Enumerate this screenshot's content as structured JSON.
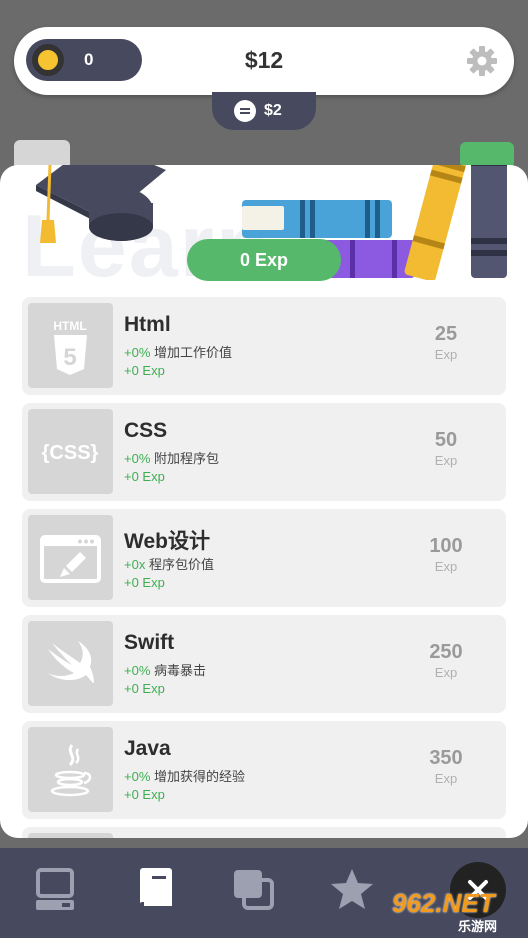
{
  "topbar": {
    "coins": "0",
    "money": "$12"
  },
  "subbar": {
    "value": "$2"
  },
  "panel": {
    "bg_word": "Learn",
    "exp": "0 Exp"
  },
  "courses": [
    {
      "name": "Html",
      "pct": "+0%",
      "effect": "增加工作价值",
      "exp": "+0 Exp",
      "cost": "25",
      "cost_unit": "Exp"
    },
    {
      "name": "CSS",
      "pct": "+0%",
      "effect": "附加程序包",
      "exp": "+0 Exp",
      "cost": "50",
      "cost_unit": "Exp"
    },
    {
      "name": "Web设计",
      "pct": "+0x",
      "effect": "程序包价值",
      "exp": "+0 Exp",
      "cost": "100",
      "cost_unit": "Exp"
    },
    {
      "name": "Swift",
      "pct": "+0%",
      "effect": "病毒暴击",
      "exp": "+0 Exp",
      "cost": "250",
      "cost_unit": "Exp"
    },
    {
      "name": "Java",
      "pct": "+0%",
      "effect": "增加获得的经验",
      "exp": "+0 Exp",
      "cost": "350",
      "cost_unit": "Exp"
    }
  ],
  "thumbs": {
    "html_label": "HTML",
    "html_digit": "5",
    "css_label": "{CSS}"
  },
  "colors": {
    "accent_green": "#55b86a",
    "nav_bg": "#474a5e",
    "coin": "#f7c431"
  },
  "icons": [
    "coin-icon",
    "gear-icon",
    "note-icon",
    "graduation-cap-icon",
    "books-icon",
    "computer-icon",
    "book-icon",
    "layers-icon",
    "star-icon",
    "close-icon"
  ],
  "watermark": {
    "brand": "962.NET",
    "sub": "乐游网"
  }
}
